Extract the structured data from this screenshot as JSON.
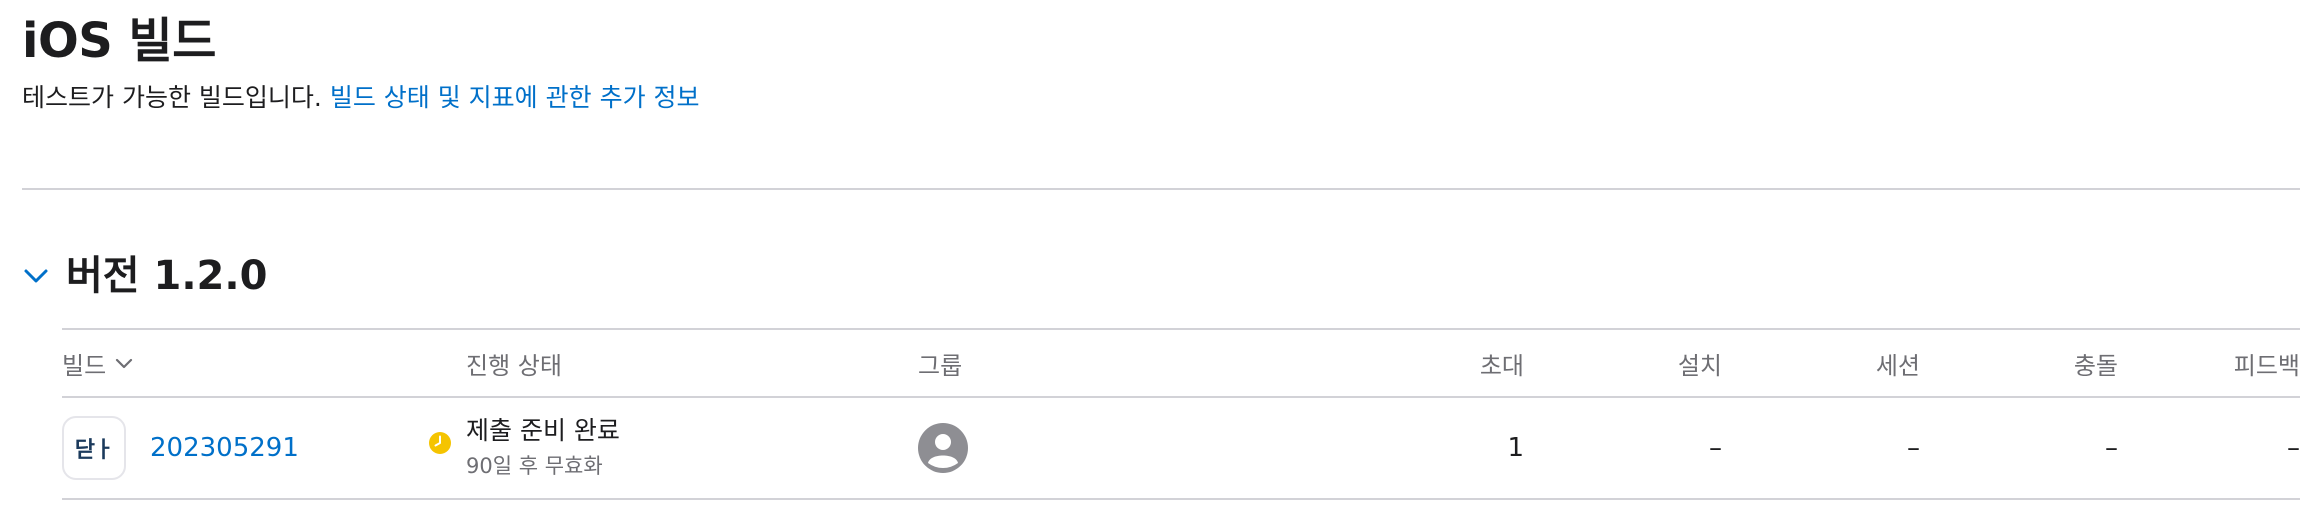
{
  "page": {
    "title": "iOS 빌드",
    "description": "테스트가 가능한 빌드입니다.",
    "info_link": "빌드 상태 및 지표에 관한 추가 정보"
  },
  "version_section": {
    "title": "버전 1.2.0",
    "expanded": true
  },
  "table": {
    "headers": {
      "build": "빌드",
      "status": "진행 상태",
      "group": "그룹",
      "invites": "초대",
      "installs": "설치",
      "sessions": "세션",
      "crashes": "충돌",
      "feedback": "피드백"
    },
    "rows": [
      {
        "app_icon_text": "닫ㅏ",
        "build_number": "202305291",
        "status": "제출 준비 완료",
        "status_sub": "90일 후 무효화",
        "group_icon": "person-icon",
        "invites": "1",
        "installs": "–",
        "sessions": "–",
        "crashes": "–",
        "feedback": "–"
      }
    ]
  },
  "colors": {
    "link": "#0070c9",
    "status_warning": "#f5c400",
    "avatar": "#8e8e93",
    "divider": "#d2d2d7"
  }
}
